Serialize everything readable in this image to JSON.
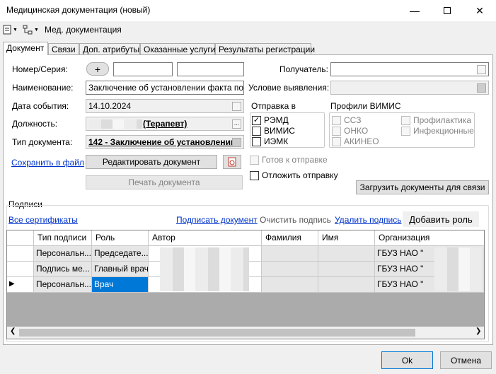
{
  "window": {
    "title": "Медицинская документация (новый)"
  },
  "toolbar": {
    "label": "Мед. документация"
  },
  "tabs": [
    "Документ",
    "Связи",
    "Доп. атрибуты",
    "Оказанные услуги",
    "Результаты регистрации"
  ],
  "form": {
    "number_label": "Номер/Серия:",
    "plus": "+",
    "name_label": "Наименование:",
    "name_value": "Заключение об установлении факта поства",
    "date_label": "Дата события:",
    "date_value": "14.10.2024",
    "position_label": "Должность:",
    "position_value": "(Терапевт)",
    "doctype_label": "Тип документа:",
    "doctype_value": "142 - Заключение об установлении",
    "recipient_label": "Получатель:",
    "condition_label": "Условие выявления:"
  },
  "links": {
    "save_to_file": "Сохранить в файл"
  },
  "buttons": {
    "edit_doc": "Редактировать документ",
    "print_doc": "Печать документа",
    "load_docs": "Загрузить документы для связи",
    "add_role": "Добавить роль",
    "ok": "Ok",
    "cancel": "Отмена"
  },
  "sending": {
    "title": "Отправка в",
    "items": [
      {
        "label": "РЭМД",
        "checked": true
      },
      {
        "label": "ВИМИС",
        "checked": false
      },
      {
        "label": "ИЭМК",
        "checked": false
      }
    ]
  },
  "vimis": {
    "title": "Профили ВИМИС",
    "col1": [
      "ССЗ",
      "ОНКО",
      "АКИНЕО"
    ],
    "col2": [
      "Профилактика",
      "Инфекционные"
    ]
  },
  "ready_label": "Готов к отправке",
  "defer_label": "Отложить отправку",
  "signatures": {
    "title": "Подписи",
    "all_certs": "Все сертификаты",
    "sign_doc": "Подписать документ",
    "clear_sign": "Очистить подпись",
    "delete_sign": "Удалить подпись",
    "columns": [
      "Тип подписи",
      "Роль",
      "Автор",
      "Фамилия",
      "Имя",
      "Организация"
    ],
    "rows": [
      {
        "type": "Персональн...",
        "role": "Председате...",
        "org": "ГБУЗ НАО \""
      },
      {
        "type": "Подпись ме...",
        "role": "Главный врач",
        "org": "ГБУЗ НАО \""
      },
      {
        "type": "Персональн...",
        "role": "Врач",
        "org": "ГБУЗ НАО \""
      }
    ],
    "current_marker": "▶"
  }
}
